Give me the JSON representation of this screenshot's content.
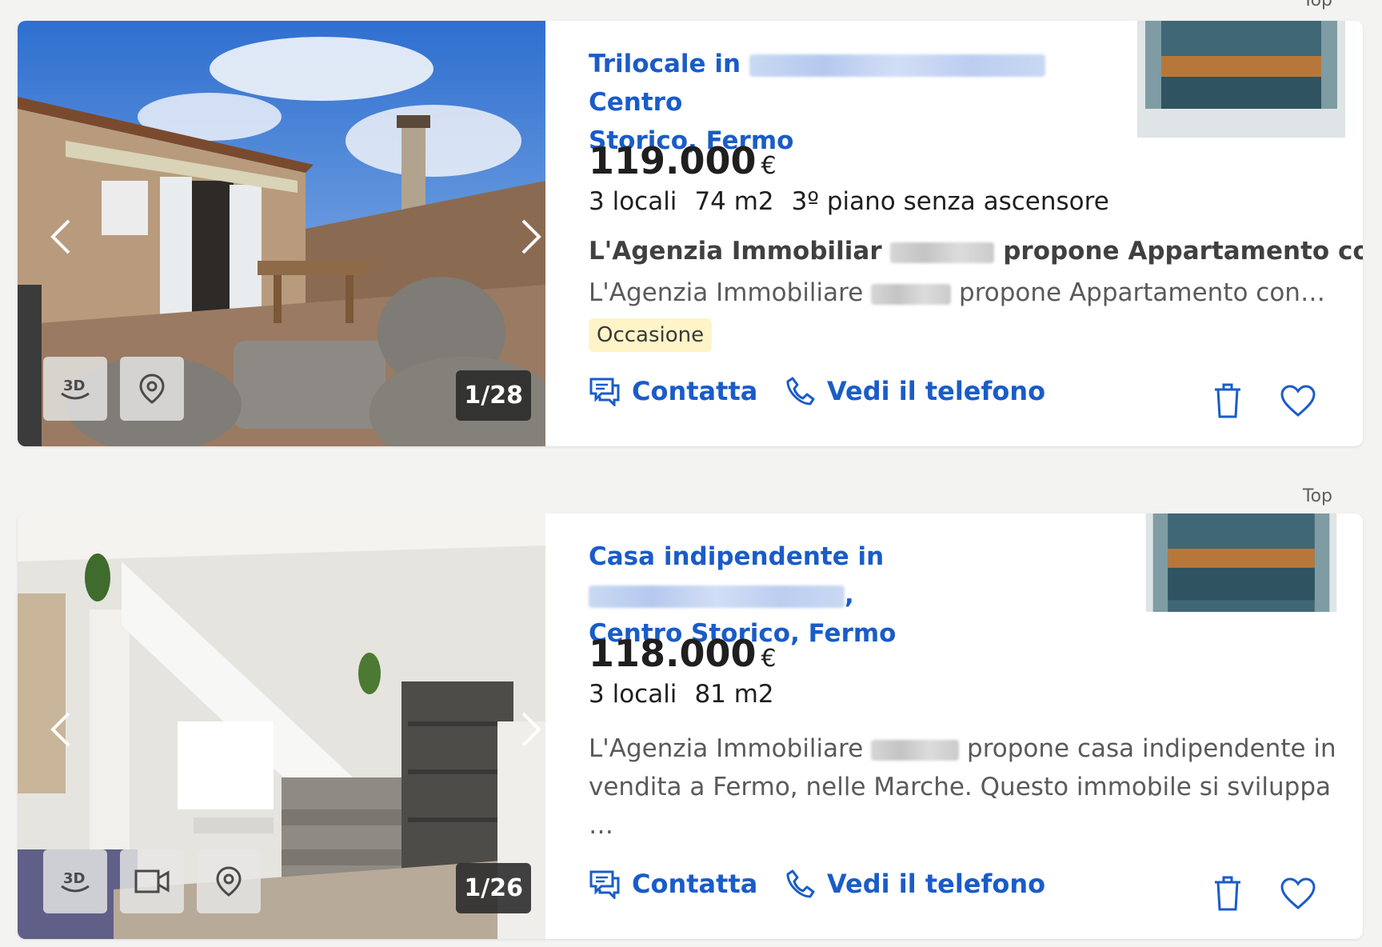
{
  "listings": [
    {
      "top_label": "Top",
      "title_prefix": "Trilocale in",
      "title_suffix": "Centro",
      "title_line2": "Storico, Fermo",
      "price": "119.000",
      "currency": "€",
      "features": [
        "3 locali",
        "74 m2",
        "3º piano senza ascensore"
      ],
      "desc_head_prefix": "L'Agenzia Immobiliar",
      "desc_head_suffix": "propone Appartamento con…",
      "desc_prefix": "L'Agenzia Immobiliare",
      "desc_suffix": "propone Appartamento con…",
      "badge": "Occasione",
      "photo_counter": "1/28",
      "contact_label": "Contatta",
      "phone_label": "Vedi il telefono"
    },
    {
      "top_label": "Top",
      "title_prefix": "Casa indipendente in",
      "title_suffix": ",",
      "title_line2": "Centro Storico, Fermo",
      "price": "118.000",
      "currency": "€",
      "features": [
        "3 locali",
        "81 m2"
      ],
      "desc_prefix": "L'Agenzia Immobiliare",
      "desc_suffix": "propone casa indipendente in",
      "desc_line2": "vendita a Fermo, nelle Marche. Questo immobile si sviluppa …",
      "photo_counter": "1/26",
      "contact_label": "Contatta",
      "phone_label": "Vedi il telefono"
    }
  ],
  "colors": {
    "link_blue": "#1a5cc8",
    "badge_bg": "#fff4c8",
    "page_bg": "#f3f3f2"
  }
}
